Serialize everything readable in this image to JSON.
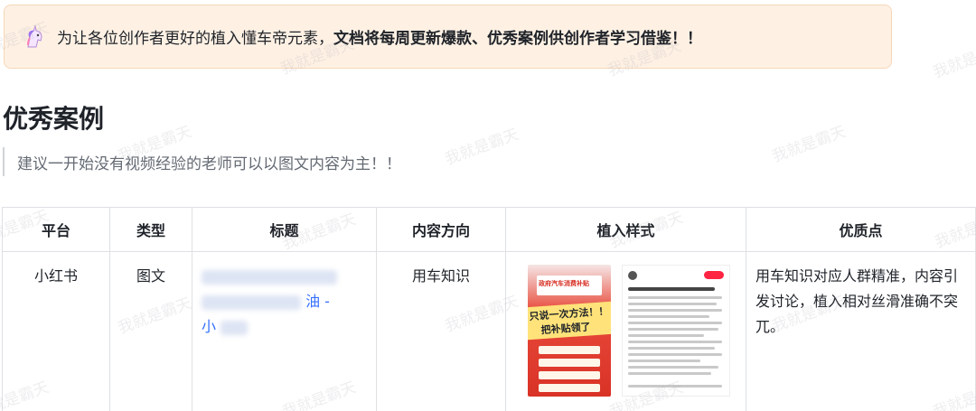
{
  "callout": {
    "icon": "unicorn-icon",
    "text_plain": "为让各位创作者更好的植入懂车帝元素，",
    "text_bold": "文档将每周更新爆款、优秀案例供创作者学习借鉴！！"
  },
  "heading": "优秀案例",
  "quote": "建议一开始没有视频经验的老师可以以图文内容为主！！",
  "table": {
    "headers": [
      "平台",
      "类型",
      "标题",
      "内容方向",
      "植入样式",
      "优质点"
    ],
    "rows": [
      {
        "platform": "小红书",
        "type": "图文",
        "title_link_end": "油 -",
        "title_link_start": "小",
        "direction": "用车知识",
        "embed_image": {
          "poster_header": "政府汽车消费补贴",
          "poster_line1": "只说一次方法！！",
          "poster_line2": "把补贴领了"
        },
        "quality": "用车知识对应人群精准，内容引发讨论，植入相对丝滑准确不突兀。"
      }
    ]
  },
  "watermark": "我就是霸天",
  "colors": {
    "callout_bg": "#fef1e4",
    "link": "#3370ff",
    "border": "#dee0e3",
    "quote_bar": "#d0d3d6"
  }
}
